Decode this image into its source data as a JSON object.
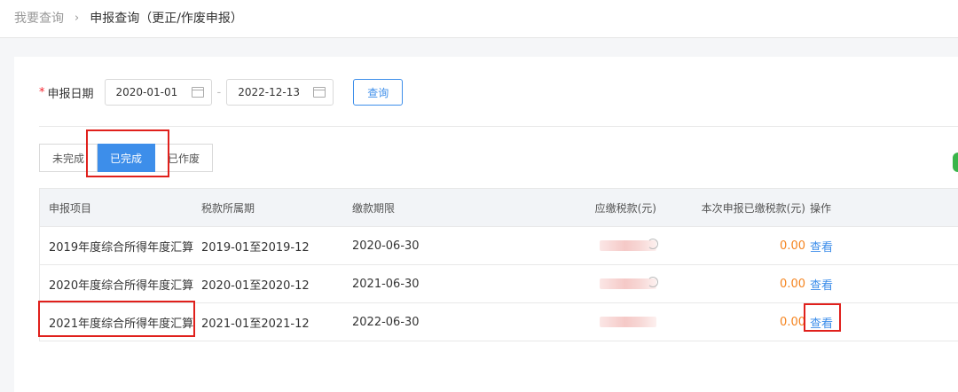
{
  "breadcrumb": {
    "parent": "我要查询",
    "separator": "›",
    "current": "申报查询（更正/作废申报）"
  },
  "form": {
    "required_mark": "*",
    "date_label": "申报日期",
    "date_from": "2020-01-01",
    "date_to": "2022-12-13",
    "range_sep": "-",
    "query_button": "查询"
  },
  "tabs": [
    {
      "label": "未完成",
      "active": false
    },
    {
      "label": "已完成",
      "active": true
    },
    {
      "label": "已作废",
      "active": false
    }
  ],
  "table": {
    "headers": [
      "申报项目",
      "税款所属期",
      "缴款期限",
      "应缴税款(元)",
      "本次申报已缴税款(元)",
      "操作"
    ],
    "rows": [
      {
        "project": "2019年度综合所得年度汇算",
        "period": "2019-01至2019-12",
        "due": "2020-06-30",
        "paid": "0.00",
        "action": "查看"
      },
      {
        "project": "2020年度综合所得年度汇算",
        "period": "2020-01至2020-12",
        "due": "2021-06-30",
        "paid": "0.00",
        "action": "查看"
      },
      {
        "project": "2021年度综合所得年度汇算",
        "period": "2021-01至2021-12",
        "due": "2022-06-30",
        "paid": "0.00",
        "action": "查看"
      }
    ]
  },
  "colors": {
    "accent": "#3d8eea",
    "highlight": "#e0201c",
    "amount": "#f5841f"
  }
}
